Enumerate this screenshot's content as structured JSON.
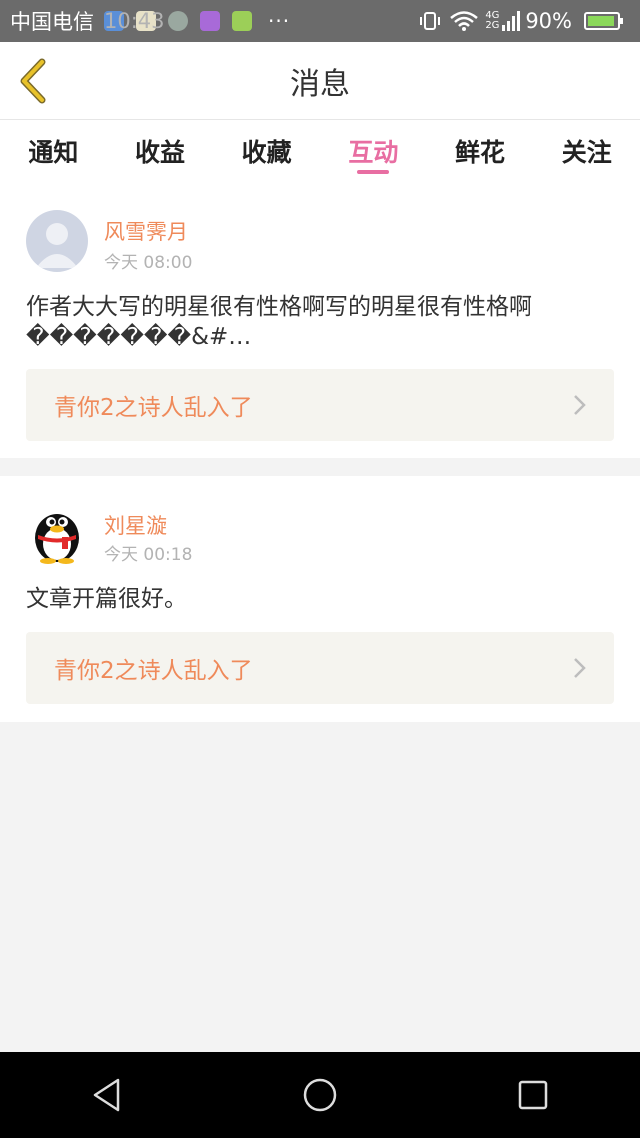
{
  "status_bar": {
    "carrier": "中国电信",
    "signal_label": "4G 2G",
    "battery": "90%",
    "time": "10:43",
    "more": "···"
  },
  "header": {
    "title": "消息"
  },
  "tabs": [
    {
      "label": "通知",
      "active": false
    },
    {
      "label": "收益",
      "active": false
    },
    {
      "label": "收藏",
      "active": false
    },
    {
      "label": "互动",
      "active": true
    },
    {
      "label": "鲜花",
      "active": false
    },
    {
      "label": "关注",
      "active": false
    }
  ],
  "messages": [
    {
      "user": "风雪霁月",
      "time": "今天 08:00",
      "content": "作者大大写的明星很有性格啊写的明星很有性格啊�������&#…",
      "link": "青你2之诗人乱入了"
    },
    {
      "user": "刘星漩",
      "time": "今天 00:18",
      "content": "文章开篇很好。",
      "link": "青你2之诗人乱入了"
    }
  ],
  "colors": {
    "accent_pink": "#e86ea2",
    "name_orange": "#ef8a5a",
    "back_yellow": "#e8c22a"
  }
}
